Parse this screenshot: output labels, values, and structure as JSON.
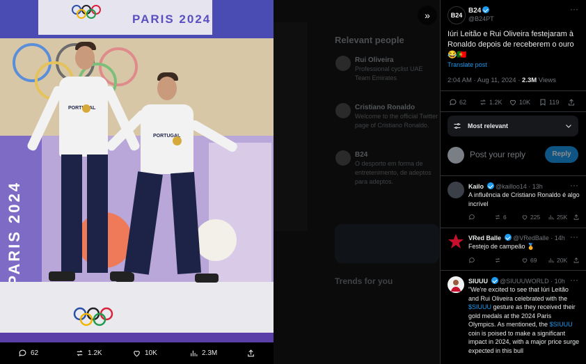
{
  "background": {
    "heading": "Relevant people",
    "people": [
      {
        "name": "Rui Oliveira",
        "text": "Professional cyclist UAE Team Emirates"
      },
      {
        "name": "Cristiano Ronaldo",
        "text": "Welcome to the official Twitter page of Cristiano Ronaldo."
      },
      {
        "name": "B24",
        "text": "O desporto em forma de entretenimento, de adeptos para adeptos."
      }
    ],
    "trends_heading": "Trends for you"
  },
  "photo": {
    "banner_text": "PARIS 2024",
    "vertical_text": "PARIS 2024",
    "jersey_text": "PORTUGAL"
  },
  "media_actions": {
    "replies": "62",
    "reposts": "1.2K",
    "likes": "10K",
    "views": "2.3M"
  },
  "post": {
    "author_initials": "B24",
    "author_name": "B24",
    "handle": "@B24PT",
    "text": "Iúri Leitão e Rui Oliveira festejaram à Ronaldo depois de receberem o ouro 😂🇵🇹",
    "translate": "Translate post",
    "time": "2:04 AM · Aug 11, 2024 · ",
    "views_value": "2.3M",
    "views_label": " Views",
    "replies": "62",
    "reposts": "1.2K",
    "likes": "10K",
    "bookmarks": "119"
  },
  "sort": {
    "label": "Most relevant"
  },
  "composer": {
    "placeholder": "Post your reply",
    "button": "Reply"
  },
  "comments": [
    {
      "name": "Kailo",
      "handle": "@kailloo14 · 13h",
      "text": "A influência de Cristiano Ronaldo é algo incrível",
      "replies": "",
      "reposts": "6",
      "likes": "225",
      "views": "25K",
      "avatar_color": "#3b3f48"
    },
    {
      "name": "VRed Balle",
      "handle": "@VRedBalle · 14h",
      "text": "Festejo de campeão 🏅",
      "replies": "",
      "reposts": "",
      "likes": "69",
      "views": "20K",
      "avatar_color": "#c8102e"
    },
    {
      "name": "SIUUU",
      "handle": "@SIUUUWORLD · 10h",
      "text_parts": [
        "\"We're excited to see that Iúri Leitão and Rui Oliveira celebrated with the ",
        "$SIUUU",
        " gesture as they received their gold medals at the 2024 Paris Olympics. As mentioned, the ",
        "$SIUUU",
        " coin is poised to make a significant impact in 2024, with a major price surge expected in this bull"
      ],
      "avatar_color": "#f2f2f2"
    }
  ],
  "colors": {
    "accent": "#1d9bf0",
    "muted": "#71767b",
    "text": "#e7e9ea"
  }
}
